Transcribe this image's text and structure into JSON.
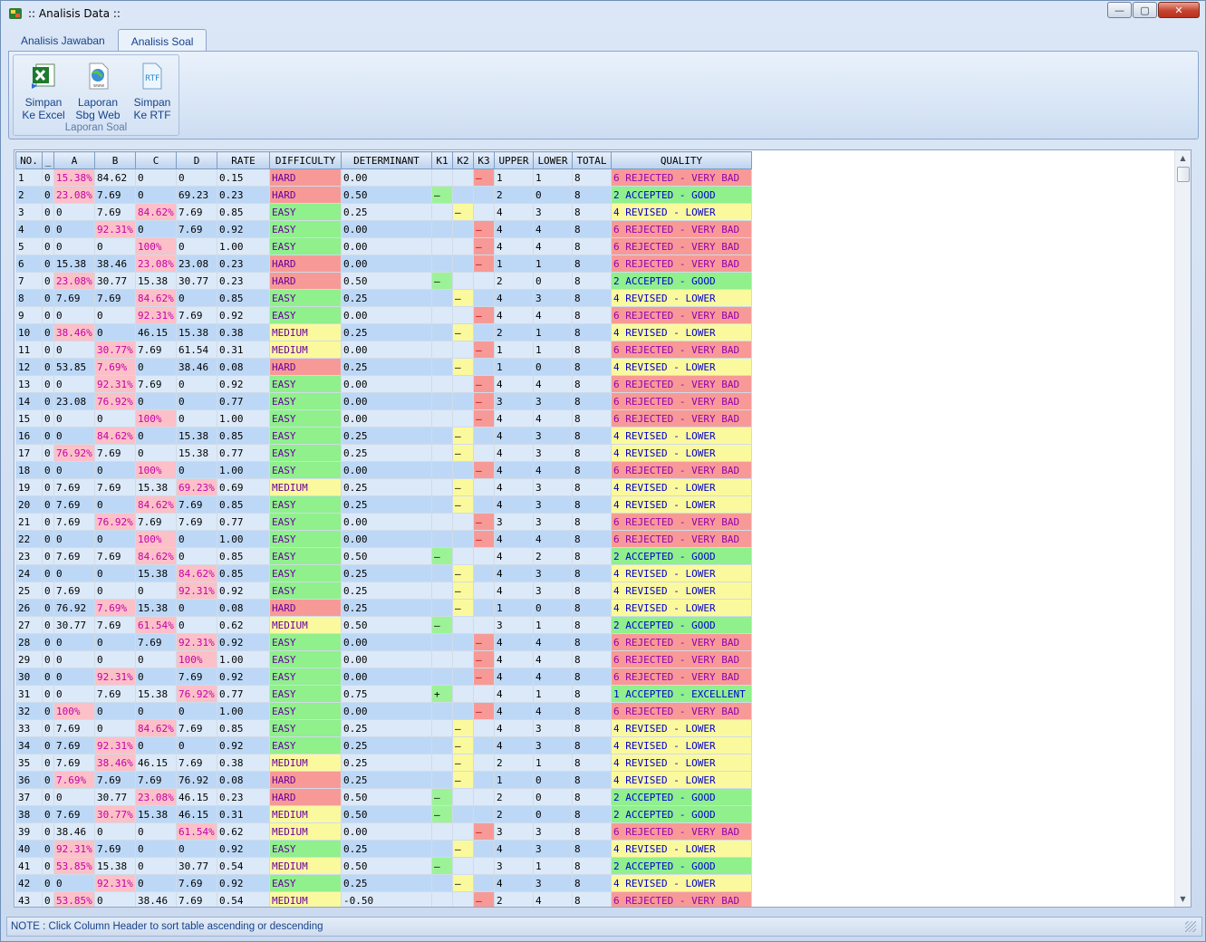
{
  "window": {
    "title": ":: Analisis Data ::",
    "controls": [
      "—",
      "▢",
      "✕"
    ]
  },
  "tabs": [
    {
      "label": "Analisis Jawaban",
      "active": false
    },
    {
      "label": "Analisis Soal",
      "active": true
    }
  ],
  "ribbon": {
    "group_label": "Laporan Soal",
    "buttons": [
      {
        "line1": "Simpan",
        "line2": "Ke Excel",
        "icon": "excel-icon"
      },
      {
        "line1": "Laporan",
        "line2": "Sbg Web",
        "icon": "web-page-icon"
      },
      {
        "line1": "Simpan",
        "line2": "Ke RTF",
        "icon": "rtf-icon"
      }
    ]
  },
  "grid": {
    "columns": [
      "NO.",
      "_",
      "A",
      "B",
      "C",
      "D",
      "RATE",
      "DIFFICULTY",
      "DETERMINANT",
      "K1",
      "K2",
      "K3",
      "UPPER",
      "LOWER",
      "TOTAL",
      "QUALITY"
    ],
    "rows": [
      [
        "1",
        "0",
        "15.38%",
        "84.62",
        "0",
        "0",
        "0.15",
        "HARD",
        "0.00",
        "",
        "",
        "–",
        "1",
        "1",
        "8",
        "6 REJECTED - VERY BAD"
      ],
      [
        "2",
        "0",
        "23.08%",
        "7.69",
        "0",
        "69.23",
        "0.23",
        "HARD",
        "0.50",
        "–",
        "",
        "",
        "2",
        "0",
        "8",
        "2 ACCEPTED - GOOD"
      ],
      [
        "3",
        "0",
        "0",
        "7.69",
        "84.62%",
        "7.69",
        "0.85",
        "EASY",
        "0.25",
        "",
        "–",
        "",
        "4",
        "3",
        "8",
        "4 REVISED  - LOWER"
      ],
      [
        "4",
        "0",
        "0",
        "92.31%",
        "0",
        "7.69",
        "0.92",
        "EASY",
        "0.00",
        "",
        "",
        "–",
        "4",
        "4",
        "8",
        "6 REJECTED - VERY BAD"
      ],
      [
        "5",
        "0",
        "0",
        "0",
        "100%",
        "0",
        "1.00",
        "EASY",
        "0.00",
        "",
        "",
        "–",
        "4",
        "4",
        "8",
        "6 REJECTED - VERY BAD"
      ],
      [
        "6",
        "0",
        "15.38",
        "38.46",
        "23.08%",
        "23.08",
        "0.23",
        "HARD",
        "0.00",
        "",
        "",
        "–",
        "1",
        "1",
        "8",
        "6 REJECTED - VERY BAD"
      ],
      [
        "7",
        "0",
        "23.08%",
        "30.77",
        "15.38",
        "30.77",
        "0.23",
        "HARD",
        "0.50",
        "–",
        "",
        "",
        "2",
        "0",
        "8",
        "2 ACCEPTED - GOOD"
      ],
      [
        "8",
        "0",
        "7.69",
        "7.69",
        "84.62%",
        "0",
        "0.85",
        "EASY",
        "0.25",
        "",
        "–",
        "",
        "4",
        "3",
        "8",
        "4 REVISED  - LOWER"
      ],
      [
        "9",
        "0",
        "0",
        "0",
        "92.31%",
        "7.69",
        "0.92",
        "EASY",
        "0.00",
        "",
        "",
        "–",
        "4",
        "4",
        "8",
        "6 REJECTED - VERY BAD"
      ],
      [
        "10",
        "0",
        "38.46%",
        "0",
        "46.15",
        "15.38",
        "0.38",
        "MEDIUM",
        "0.25",
        "",
        "–",
        "",
        "2",
        "1",
        "8",
        "4 REVISED  - LOWER"
      ],
      [
        "11",
        "0",
        "0",
        "30.77%",
        "7.69",
        "61.54",
        "0.31",
        "MEDIUM",
        "0.00",
        "",
        "",
        "–",
        "1",
        "1",
        "8",
        "6 REJECTED - VERY BAD"
      ],
      [
        "12",
        "0",
        "53.85",
        "7.69%",
        "0",
        "38.46",
        "0.08",
        "HARD",
        "0.25",
        "",
        "–",
        "",
        "1",
        "0",
        "8",
        "4 REVISED  - LOWER"
      ],
      [
        "13",
        "0",
        "0",
        "92.31%",
        "7.69",
        "0",
        "0.92",
        "EASY",
        "0.00",
        "",
        "",
        "–",
        "4",
        "4",
        "8",
        "6 REJECTED - VERY BAD"
      ],
      [
        "14",
        "0",
        "23.08",
        "76.92%",
        "0",
        "0",
        "0.77",
        "EASY",
        "0.00",
        "",
        "",
        "–",
        "3",
        "3",
        "8",
        "6 REJECTED - VERY BAD"
      ],
      [
        "15",
        "0",
        "0",
        "0",
        "100%",
        "0",
        "1.00",
        "EASY",
        "0.00",
        "",
        "",
        "–",
        "4",
        "4",
        "8",
        "6 REJECTED - VERY BAD"
      ],
      [
        "16",
        "0",
        "0",
        "84.62%",
        "0",
        "15.38",
        "0.85",
        "EASY",
        "0.25",
        "",
        "–",
        "",
        "4",
        "3",
        "8",
        "4 REVISED  - LOWER"
      ],
      [
        "17",
        "0",
        "76.92%",
        "7.69",
        "0",
        "15.38",
        "0.77",
        "EASY",
        "0.25",
        "",
        "–",
        "",
        "4",
        "3",
        "8",
        "4 REVISED  - LOWER"
      ],
      [
        "18",
        "0",
        "0",
        "0",
        "100%",
        "0",
        "1.00",
        "EASY",
        "0.00",
        "",
        "",
        "–",
        "4",
        "4",
        "8",
        "6 REJECTED - VERY BAD"
      ],
      [
        "19",
        "0",
        "7.69",
        "7.69",
        "15.38",
        "69.23%",
        "0.69",
        "MEDIUM",
        "0.25",
        "",
        "–",
        "",
        "4",
        "3",
        "8",
        "4 REVISED  - LOWER"
      ],
      [
        "20",
        "0",
        "7.69",
        "0",
        "84.62%",
        "7.69",
        "0.85",
        "EASY",
        "0.25",
        "",
        "–",
        "",
        "4",
        "3",
        "8",
        "4 REVISED  - LOWER"
      ],
      [
        "21",
        "0",
        "7.69",
        "76.92%",
        "7.69",
        "7.69",
        "0.77",
        "EASY",
        "0.00",
        "",
        "",
        "–",
        "3",
        "3",
        "8",
        "6 REJECTED - VERY BAD"
      ],
      [
        "22",
        "0",
        "0",
        "0",
        "100%",
        "0",
        "1.00",
        "EASY",
        "0.00",
        "",
        "",
        "–",
        "4",
        "4",
        "8",
        "6 REJECTED - VERY BAD"
      ],
      [
        "23",
        "0",
        "7.69",
        "7.69",
        "84.62%",
        "0",
        "0.85",
        "EASY",
        "0.50",
        "–",
        "",
        "",
        "4",
        "2",
        "8",
        "2 ACCEPTED - GOOD"
      ],
      [
        "24",
        "0",
        "0",
        "0",
        "15.38",
        "84.62%",
        "0.85",
        "EASY",
        "0.25",
        "",
        "–",
        "",
        "4",
        "3",
        "8",
        "4 REVISED  - LOWER"
      ],
      [
        "25",
        "0",
        "7.69",
        "0",
        "0",
        "92.31%",
        "0.92",
        "EASY",
        "0.25",
        "",
        "–",
        "",
        "4",
        "3",
        "8",
        "4 REVISED  - LOWER"
      ],
      [
        "26",
        "0",
        "76.92",
        "7.69%",
        "15.38",
        "0",
        "0.08",
        "HARD",
        "0.25",
        "",
        "–",
        "",
        "1",
        "0",
        "8",
        "4 REVISED  - LOWER"
      ],
      [
        "27",
        "0",
        "30.77",
        "7.69",
        "61.54%",
        "0",
        "0.62",
        "MEDIUM",
        "0.50",
        "–",
        "",
        "",
        "3",
        "1",
        "8",
        "2 ACCEPTED - GOOD"
      ],
      [
        "28",
        "0",
        "0",
        "0",
        "7.69",
        "92.31%",
        "0.92",
        "EASY",
        "0.00",
        "",
        "",
        "–",
        "4",
        "4",
        "8",
        "6 REJECTED - VERY BAD"
      ],
      [
        "29",
        "0",
        "0",
        "0",
        "0",
        "100%",
        "1.00",
        "EASY",
        "0.00",
        "",
        "",
        "–",
        "4",
        "4",
        "8",
        "6 REJECTED - VERY BAD"
      ],
      [
        "30",
        "0",
        "0",
        "92.31%",
        "0",
        "7.69",
        "0.92",
        "EASY",
        "0.00",
        "",
        "",
        "–",
        "4",
        "4",
        "8",
        "6 REJECTED - VERY BAD"
      ],
      [
        "31",
        "0",
        "0",
        "7.69",
        "15.38",
        "76.92%",
        "0.77",
        "EASY",
        "0.75",
        "+",
        "",
        "",
        "4",
        "1",
        "8",
        "1 ACCEPTED - EXCELLENT"
      ],
      [
        "32",
        "0",
        "100%",
        "0",
        "0",
        "0",
        "1.00",
        "EASY",
        "0.00",
        "",
        "",
        "–",
        "4",
        "4",
        "8",
        "6 REJECTED - VERY BAD"
      ],
      [
        "33",
        "0",
        "7.69",
        "0",
        "84.62%",
        "7.69",
        "0.85",
        "EASY",
        "0.25",
        "",
        "–",
        "",
        "4",
        "3",
        "8",
        "4 REVISED  - LOWER"
      ],
      [
        "34",
        "0",
        "7.69",
        "92.31%",
        "0",
        "0",
        "0.92",
        "EASY",
        "0.25",
        "",
        "–",
        "",
        "4",
        "3",
        "8",
        "4 REVISED  - LOWER"
      ],
      [
        "35",
        "0",
        "7.69",
        "38.46%",
        "46.15",
        "7.69",
        "0.38",
        "MEDIUM",
        "0.25",
        "",
        "–",
        "",
        "2",
        "1",
        "8",
        "4 REVISED  - LOWER"
      ],
      [
        "36",
        "0",
        "7.69%",
        "7.69",
        "7.69",
        "76.92",
        "0.08",
        "HARD",
        "0.25",
        "",
        "–",
        "",
        "1",
        "0",
        "8",
        "4 REVISED  - LOWER"
      ],
      [
        "37",
        "0",
        "0",
        "30.77",
        "23.08%",
        "46.15",
        "0.23",
        "HARD",
        "0.50",
        "–",
        "",
        "",
        "2",
        "0",
        "8",
        "2 ACCEPTED - GOOD"
      ],
      [
        "38",
        "0",
        "7.69",
        "30.77%",
        "15.38",
        "46.15",
        "0.31",
        "MEDIUM",
        "0.50",
        "–",
        "",
        "",
        "2",
        "0",
        "8",
        "2 ACCEPTED - GOOD"
      ],
      [
        "39",
        "0",
        "38.46",
        "0",
        "0",
        "61.54%",
        "0.62",
        "MEDIUM",
        "0.00",
        "",
        "",
        "–",
        "3",
        "3",
        "8",
        "6 REJECTED - VERY BAD"
      ],
      [
        "40",
        "0",
        "92.31%",
        "7.69",
        "0",
        "0",
        "0.92",
        "EASY",
        "0.25",
        "",
        "–",
        "",
        "4",
        "3",
        "8",
        "4 REVISED  - LOWER"
      ],
      [
        "41",
        "0",
        "53.85%",
        "15.38",
        "0",
        "30.77",
        "0.54",
        "MEDIUM",
        "0.50",
        "–",
        "",
        "",
        "3",
        "1",
        "8",
        "2 ACCEPTED - GOOD"
      ],
      [
        "42",
        "0",
        "0",
        "92.31%",
        "0",
        "7.69",
        "0.92",
        "EASY",
        "0.25",
        "",
        "–",
        "",
        "4",
        "3",
        "8",
        "4 REVISED  - LOWER"
      ],
      [
        "43",
        "0",
        "53.85%",
        "0",
        "38.46",
        "7.69",
        "0.54",
        "MEDIUM",
        "-0.50",
        "",
        "",
        "–",
        "2",
        "4",
        "8",
        "6 REJECTED - VERY BAD"
      ]
    ]
  },
  "status": {
    "note": "NOTE : Click Column Header to sort table ascending or descending"
  }
}
